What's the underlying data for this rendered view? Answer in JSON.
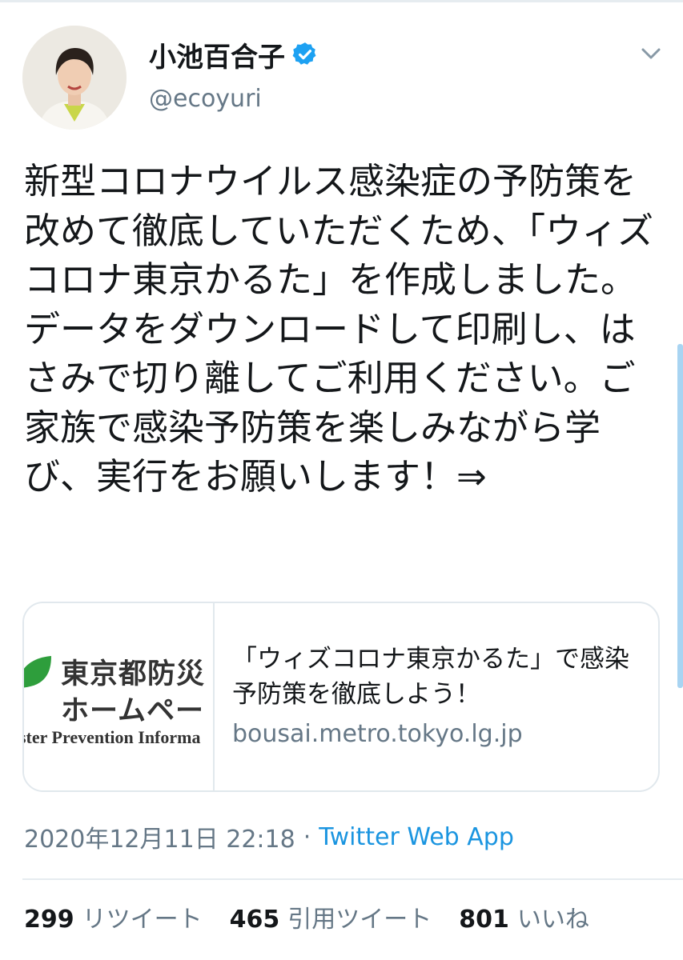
{
  "author": {
    "display_name": "小池百合子",
    "handle": "@ecoyuri",
    "avatar_icon": "profile-photo",
    "verified_icon": "verified-badge-icon",
    "verified_color": "#1da1f2"
  },
  "tweet": {
    "text": "新型コロナウイルス感染症の予防策を改めて徹底していただくため、「ウィズコロナ東京かるた」を作成しました。データをダウンロードして印刷し、はさみで切り離してご利用ください。ご家族で感染予防策を楽しみながら学び、実行をお願いします！⇒"
  },
  "card": {
    "thumb_line1": "東京都防災",
    "thumb_line2": "ホームペー",
    "thumb_line3": "ster Prevention Informa",
    "title": "「ウィズコロナ東京かるた」で感染予防策を徹底しよう！",
    "domain": "bousai.metro.tokyo.lg.jp"
  },
  "meta": {
    "timestamp": "2020年12月11日 22:18",
    "separator": "·",
    "source": "Twitter Web App"
  },
  "stats": {
    "retweets_count": "299",
    "retweets_label": "リツイート",
    "quotes_count": "465",
    "quotes_label": "引用ツイート",
    "likes_count": "801",
    "likes_label": "いいね"
  },
  "colors": {
    "link": "#1b95e0",
    "secondary_text": "#657786",
    "primary_text": "#14171a",
    "border": "#e1e8ed",
    "leaf_green": "#2e9e3c"
  }
}
